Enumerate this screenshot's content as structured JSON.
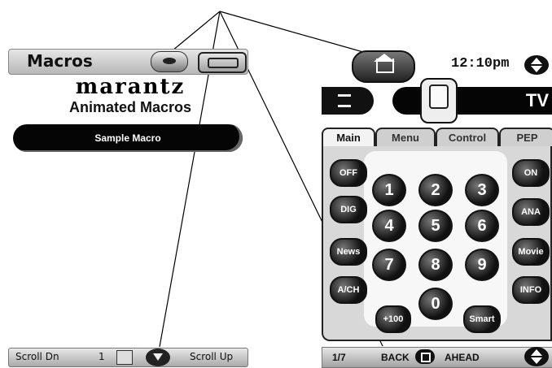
{
  "left_panel": {
    "header_title": "Macros",
    "brand": "marantz",
    "subtitle": "Animated Macros",
    "macro_button": "Sample Macro",
    "footer": {
      "scroll_down": "Scroll Dn",
      "page": "1",
      "scroll_up": "Scroll Up"
    }
  },
  "right_panel": {
    "time": "12:10pm",
    "device_label": "TV",
    "tabs": [
      "Main",
      "Menu",
      "Control",
      "PEP"
    ],
    "left_keys": [
      "OFF",
      "DIG",
      "News",
      "A/CH"
    ],
    "right_keys": [
      "ON",
      "ANA",
      "Movie",
      "INFO"
    ],
    "digits": [
      "1",
      "2",
      "3",
      "4",
      "5",
      "6",
      "7",
      "8",
      "9",
      "0"
    ],
    "plus100": "+100",
    "smart": "Smart",
    "footer": {
      "page": "1/7",
      "back": "BACK",
      "ahead": "AHEAD"
    }
  },
  "icons": {
    "header_round": "round-pill-icon",
    "device": "device-icon",
    "home": "home-icon",
    "list": "list-icon",
    "scroll_arrows": "up-down-arrows-icon"
  }
}
